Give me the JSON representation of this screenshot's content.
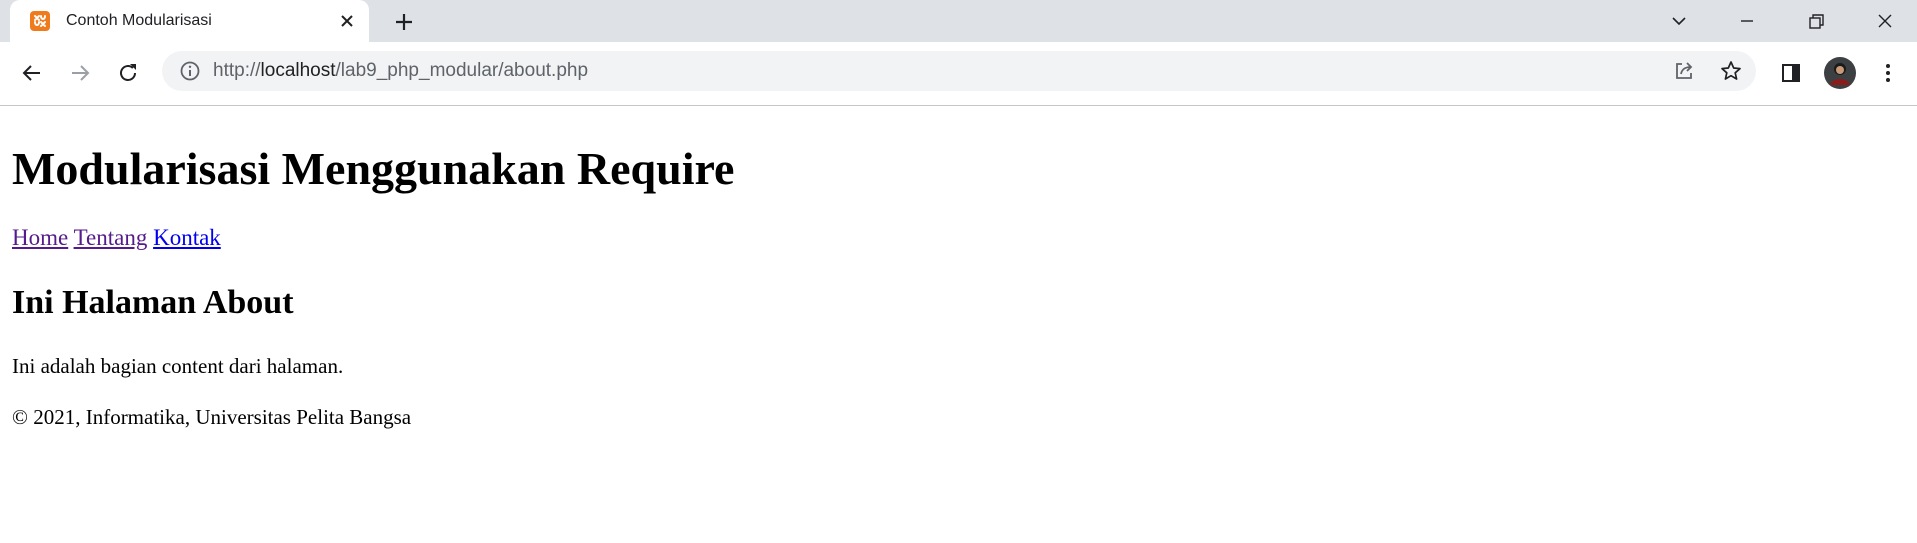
{
  "browser": {
    "tab": {
      "title": "Contoh Modularisasi"
    },
    "address_bar": {
      "scheme": "http://",
      "host": "localhost",
      "path": "/lab9_php_modular/about.php"
    },
    "icons": {
      "favicon": "xampp-icon",
      "tab_close": "close-icon",
      "new_tab": "plus-icon",
      "tab_search": "chevron-down-icon",
      "minimize": "minimize-icon",
      "restore": "restore-icon",
      "close_window": "close-icon",
      "back": "arrow-left-icon",
      "forward": "arrow-right-icon",
      "reload": "reload-icon",
      "site_info": "info-icon",
      "share": "share-icon",
      "bookmark": "star-icon",
      "side_panel": "side-panel-icon",
      "profile": "avatar",
      "menu": "kebab-menu-icon"
    },
    "colors": {
      "tabstrip": "#dee1e6",
      "favicon": "#f07b1c",
      "link": "#0000ee",
      "visited_link": "#551a8b"
    }
  },
  "page": {
    "title": "Modularisasi Menggunakan Require",
    "nav": [
      {
        "label": "Home"
      },
      {
        "label": "Tentang"
      },
      {
        "label": "Kontak"
      }
    ],
    "heading": "Ini Halaman About",
    "content": "Ini adalah bagian content dari halaman.",
    "footer": "© 2021, Informatika, Universitas Pelita Bangsa"
  }
}
